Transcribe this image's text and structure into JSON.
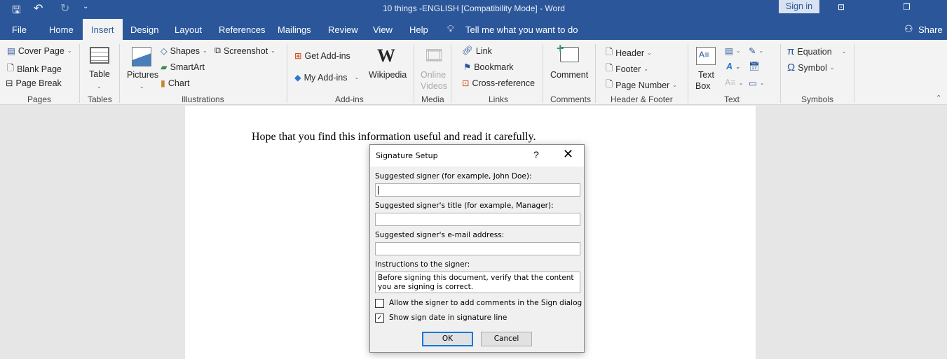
{
  "title": "10 things -ENGLISH [Compatibility Mode]  -  Word",
  "sign_in": "Sign in",
  "tabs": [
    "File",
    "Home",
    "Insert",
    "Design",
    "Layout",
    "References",
    "Mailings",
    "Review",
    "View",
    "Help"
  ],
  "tell_me": "Tell me what you want to do",
  "share": "Share",
  "ribbon": {
    "pages": {
      "cover": "Cover Page",
      "blank": "Blank Page",
      "break": "Page Break",
      "label": "Pages"
    },
    "tables": {
      "table": "Table",
      "label": "Tables"
    },
    "illustrations": {
      "pictures": "Pictures",
      "shapes": "Shapes",
      "screenshot": "Screenshot",
      "smartart": "SmartArt",
      "chart": "Chart",
      "label": "Illustrations"
    },
    "addins": {
      "get": "Get Add-ins",
      "my": "My Add-ins",
      "wikipedia": "Wikipedia",
      "label": "Add-ins"
    },
    "media": {
      "online": "Online",
      "videos": "Videos",
      "label": "Media"
    },
    "links": {
      "link": "Link",
      "bookmark": "Bookmark",
      "crossref": "Cross-reference",
      "label": "Links"
    },
    "comments": {
      "comment": "Comment",
      "label": "Comments"
    },
    "headerfooter": {
      "header": "Header",
      "footer": "Footer",
      "pagenumber": "Page Number",
      "label": "Header & Footer"
    },
    "text": {
      "text": "Text",
      "box": "Box",
      "label": "Text"
    },
    "symbols": {
      "equation": "Equation",
      "symbol": "Symbol",
      "label": "Symbols"
    }
  },
  "document": {
    "line": "Hope that you find this information useful and read it carefully."
  },
  "dialog": {
    "title": "Signature Setup",
    "help": "?",
    "signer_label": "Suggested signer (for example, John Doe):",
    "signer_value": "",
    "title_label": "Suggested signer's title (for example, Manager):",
    "title_value": "",
    "email_label": "Suggested signer's e-mail address:",
    "email_value": "",
    "instructions_label": "Instructions to the signer:",
    "instructions_value": "Before signing this document, verify that the content you are signing is correct.",
    "allow_comments": "Allow the signer to add comments in the Sign dialog",
    "allow_comments_checked": false,
    "show_date": "Show sign date in signature line",
    "show_date_checked": true,
    "ok": "OK",
    "cancel": "Cancel"
  }
}
